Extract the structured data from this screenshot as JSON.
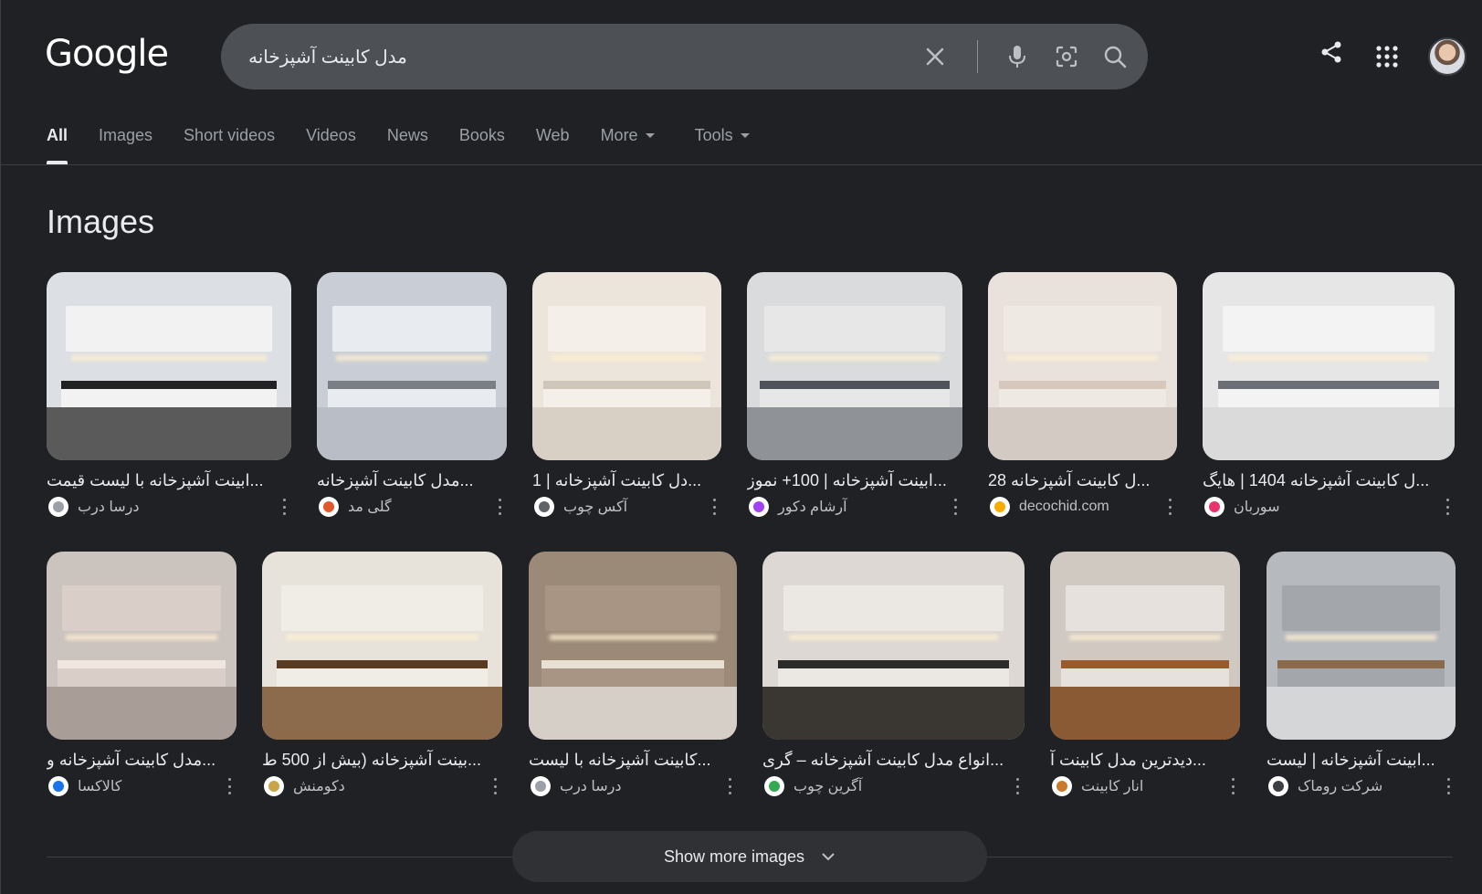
{
  "header": {
    "logo": "Google",
    "search": {
      "query": "مدل کابینت آشپزخانه"
    }
  },
  "tabs": [
    {
      "label": "All",
      "active": true
    },
    {
      "label": "Images"
    },
    {
      "label": "Short videos"
    },
    {
      "label": "Videos"
    },
    {
      "label": "News"
    },
    {
      "label": "Books"
    },
    {
      "label": "Web"
    },
    {
      "label": "More",
      "caret": true
    },
    {
      "label": "Tools",
      "caret": true
    }
  ],
  "section_title": "Images",
  "row1": [
    {
      "caption": "...ابینت آشپزخانه با لیست قیمت",
      "source": "درسا درب",
      "fav_color": "#9aa0a6",
      "wall": "#dcdfe3",
      "cab": "#f2f2f2",
      "floor": "#5a5a5a",
      "counter": "#222222"
    },
    {
      "caption": "...مدل کابینت آشپزخانه",
      "source": "گلی مد",
      "fav_color": "#e0592a",
      "wall": "#c9ced6",
      "cab": "#e8ebef",
      "floor": "#b9bec6",
      "counter": "#7a7f86"
    },
    {
      "caption": "...دل کابینت آشپزخانه | 1",
      "source": "آکس چوب",
      "fav_color": "#5f6368",
      "wall": "#ece5db",
      "cab": "#f4efe8",
      "floor": "#d8d0c4",
      "counter": "#cfc6ba"
    },
    {
      "caption": "...ابینت آشپزخانه | 100+ نموز",
      "source": "آرشام دکور",
      "fav_color": "#a142f4",
      "wall": "#d9dbdd",
      "cab": "#e7e7e7",
      "floor": "#8f9296",
      "counter": "#50545a"
    },
    {
      "caption": "...ل کابینت آشپزخانه 28",
      "source": "decochid.com",
      "fav_color": "#f9ab00",
      "wall": "#e9e2dc",
      "cab": "#efe9e4",
      "floor": "#d3cbc3",
      "counter": "#d7c8bd"
    },
    {
      "caption": "...ل کابینت آشپزخانه 1404 | هایگ",
      "source": "سوربان",
      "fav_color": "#e8336c",
      "wall": "#e6e6e6",
      "cab": "#f3f3f3",
      "floor": "#dadada",
      "counter": "#6b6f75"
    }
  ],
  "row2": [
    {
      "caption": "...مدل کابینت آشپزخانه و",
      "source": "کالاکسا",
      "fav_color": "#1a73e8",
      "wall": "#cbc3be",
      "cab": "#d9cfc8",
      "floor": "#a89e97",
      "counter": "#efe7df"
    },
    {
      "caption": "...بینت آشپزخانه (بیش از 500 ط",
      "source": "دکومنش",
      "fav_color": "#c9a44a",
      "wall": "#e7e2da",
      "cab": "#f0ece6",
      "floor": "#8c6b4c",
      "counter": "#5a3b22"
    },
    {
      "caption": "...کابینت آشپزخانه با لیست",
      "source": "درسا درب",
      "fav_color": "#9aa0a6",
      "wall": "#9b8a78",
      "cab": "#a89583",
      "floor": "#d6cfc8",
      "counter": "#e9e0d4"
    },
    {
      "caption": "...انواع مدل کابینت آشپزخانه – گری",
      "source": "آگرین چوب",
      "fav_color": "#34a853",
      "wall": "#ddd8d3",
      "cab": "#ebe7e3",
      "floor": "#3a3632",
      "counter": "#2b2b2b"
    },
    {
      "caption": "...دیدترین مدل کابینت آ",
      "source": "انار کابینت",
      "fav_color": "#c97a2b",
      "wall": "#cfc9c2",
      "cab": "#e6e1dc",
      "floor": "#8a5a34",
      "counter": "#9b5a2c"
    },
    {
      "caption": "...ابینت آشپزخانه | لیست",
      "source": "شرکت روماک",
      "fav_color": "#3c4043",
      "wall": "#b6b9bd",
      "cab": "#a3a7ac",
      "floor": "#d4d6d8",
      "counter": "#8a6a4a"
    }
  ],
  "show_more": "Show more images"
}
